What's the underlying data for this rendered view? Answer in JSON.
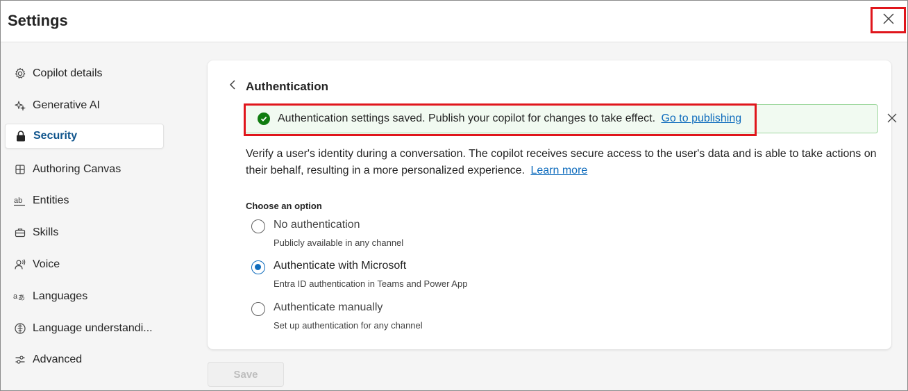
{
  "header": {
    "title": "Settings",
    "close_icon": "close-icon"
  },
  "sidebar": {
    "items": [
      {
        "label": "Copilot details",
        "icon": "gear-icon"
      },
      {
        "label": "Generative AI",
        "icon": "sparkle-icon"
      },
      {
        "label": "Security",
        "icon": "lock-icon",
        "active": true
      },
      {
        "label": "Authoring Canvas",
        "icon": "grid-icon"
      },
      {
        "label": "Entities",
        "icon": "ab-text-icon"
      },
      {
        "label": "Skills",
        "icon": "briefcase-icon"
      },
      {
        "label": "Voice",
        "icon": "voice-person-icon"
      },
      {
        "label": "Languages",
        "icon": "translate-icon"
      },
      {
        "label": "Language understandi...",
        "icon": "brain-icon"
      },
      {
        "label": "Advanced",
        "icon": "sliders-icon"
      }
    ]
  },
  "main": {
    "title": "Authentication",
    "banner": {
      "text": "Authentication settings saved. Publish your copilot for changes to take effect.",
      "link": "Go to publishing",
      "status_color": "#107c10"
    },
    "description": "Verify a user's identity during a conversation. The copilot receives secure access to the user's data and is able to take actions on their behalf, resulting in a more personalized experience.",
    "description_link": "Learn more",
    "option_label": "Choose an option",
    "options": [
      {
        "title": "No authentication",
        "subtitle": "Publicly available in any channel",
        "checked": false
      },
      {
        "title": "Authenticate with Microsoft",
        "subtitle": "Entra ID authentication in Teams and Power App",
        "checked": true
      },
      {
        "title": "Authenticate manually",
        "subtitle": "Set up authentication for any channel",
        "checked": false
      }
    ]
  },
  "footer": {
    "save_label": "Save"
  },
  "colors": {
    "accent": "#0f6cbd",
    "highlight": "#e0161c",
    "success": "#107c10"
  }
}
